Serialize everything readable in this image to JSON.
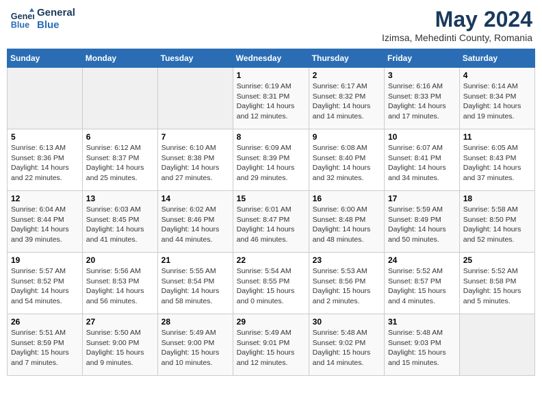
{
  "header": {
    "logo_line1": "General",
    "logo_line2": "Blue",
    "month_year": "May 2024",
    "location": "Izimsa, Mehedinti County, Romania"
  },
  "days_of_week": [
    "Sunday",
    "Monday",
    "Tuesday",
    "Wednesday",
    "Thursday",
    "Friday",
    "Saturday"
  ],
  "weeks": [
    [
      {
        "day": "",
        "info": ""
      },
      {
        "day": "",
        "info": ""
      },
      {
        "day": "",
        "info": ""
      },
      {
        "day": "1",
        "info": "Sunrise: 6:19 AM\nSunset: 8:31 PM\nDaylight: 14 hours\nand 12 minutes."
      },
      {
        "day": "2",
        "info": "Sunrise: 6:17 AM\nSunset: 8:32 PM\nDaylight: 14 hours\nand 14 minutes."
      },
      {
        "day": "3",
        "info": "Sunrise: 6:16 AM\nSunset: 8:33 PM\nDaylight: 14 hours\nand 17 minutes."
      },
      {
        "day": "4",
        "info": "Sunrise: 6:14 AM\nSunset: 8:34 PM\nDaylight: 14 hours\nand 19 minutes."
      }
    ],
    [
      {
        "day": "5",
        "info": "Sunrise: 6:13 AM\nSunset: 8:36 PM\nDaylight: 14 hours\nand 22 minutes."
      },
      {
        "day": "6",
        "info": "Sunrise: 6:12 AM\nSunset: 8:37 PM\nDaylight: 14 hours\nand 25 minutes."
      },
      {
        "day": "7",
        "info": "Sunrise: 6:10 AM\nSunset: 8:38 PM\nDaylight: 14 hours\nand 27 minutes."
      },
      {
        "day": "8",
        "info": "Sunrise: 6:09 AM\nSunset: 8:39 PM\nDaylight: 14 hours\nand 29 minutes."
      },
      {
        "day": "9",
        "info": "Sunrise: 6:08 AM\nSunset: 8:40 PM\nDaylight: 14 hours\nand 32 minutes."
      },
      {
        "day": "10",
        "info": "Sunrise: 6:07 AM\nSunset: 8:41 PM\nDaylight: 14 hours\nand 34 minutes."
      },
      {
        "day": "11",
        "info": "Sunrise: 6:05 AM\nSunset: 8:43 PM\nDaylight: 14 hours\nand 37 minutes."
      }
    ],
    [
      {
        "day": "12",
        "info": "Sunrise: 6:04 AM\nSunset: 8:44 PM\nDaylight: 14 hours\nand 39 minutes."
      },
      {
        "day": "13",
        "info": "Sunrise: 6:03 AM\nSunset: 8:45 PM\nDaylight: 14 hours\nand 41 minutes."
      },
      {
        "day": "14",
        "info": "Sunrise: 6:02 AM\nSunset: 8:46 PM\nDaylight: 14 hours\nand 44 minutes."
      },
      {
        "day": "15",
        "info": "Sunrise: 6:01 AM\nSunset: 8:47 PM\nDaylight: 14 hours\nand 46 minutes."
      },
      {
        "day": "16",
        "info": "Sunrise: 6:00 AM\nSunset: 8:48 PM\nDaylight: 14 hours\nand 48 minutes."
      },
      {
        "day": "17",
        "info": "Sunrise: 5:59 AM\nSunset: 8:49 PM\nDaylight: 14 hours\nand 50 minutes."
      },
      {
        "day": "18",
        "info": "Sunrise: 5:58 AM\nSunset: 8:50 PM\nDaylight: 14 hours\nand 52 minutes."
      }
    ],
    [
      {
        "day": "19",
        "info": "Sunrise: 5:57 AM\nSunset: 8:52 PM\nDaylight: 14 hours\nand 54 minutes."
      },
      {
        "day": "20",
        "info": "Sunrise: 5:56 AM\nSunset: 8:53 PM\nDaylight: 14 hours\nand 56 minutes."
      },
      {
        "day": "21",
        "info": "Sunrise: 5:55 AM\nSunset: 8:54 PM\nDaylight: 14 hours\nand 58 minutes."
      },
      {
        "day": "22",
        "info": "Sunrise: 5:54 AM\nSunset: 8:55 PM\nDaylight: 15 hours\nand 0 minutes."
      },
      {
        "day": "23",
        "info": "Sunrise: 5:53 AM\nSunset: 8:56 PM\nDaylight: 15 hours\nand 2 minutes."
      },
      {
        "day": "24",
        "info": "Sunrise: 5:52 AM\nSunset: 8:57 PM\nDaylight: 15 hours\nand 4 minutes."
      },
      {
        "day": "25",
        "info": "Sunrise: 5:52 AM\nSunset: 8:58 PM\nDaylight: 15 hours\nand 5 minutes."
      }
    ],
    [
      {
        "day": "26",
        "info": "Sunrise: 5:51 AM\nSunset: 8:59 PM\nDaylight: 15 hours\nand 7 minutes."
      },
      {
        "day": "27",
        "info": "Sunrise: 5:50 AM\nSunset: 9:00 PM\nDaylight: 15 hours\nand 9 minutes."
      },
      {
        "day": "28",
        "info": "Sunrise: 5:49 AM\nSunset: 9:00 PM\nDaylight: 15 hours\nand 10 minutes."
      },
      {
        "day": "29",
        "info": "Sunrise: 5:49 AM\nSunset: 9:01 PM\nDaylight: 15 hours\nand 12 minutes."
      },
      {
        "day": "30",
        "info": "Sunrise: 5:48 AM\nSunset: 9:02 PM\nDaylight: 15 hours\nand 14 minutes."
      },
      {
        "day": "31",
        "info": "Sunrise: 5:48 AM\nSunset: 9:03 PM\nDaylight: 15 hours\nand 15 minutes."
      },
      {
        "day": "",
        "info": ""
      }
    ]
  ]
}
